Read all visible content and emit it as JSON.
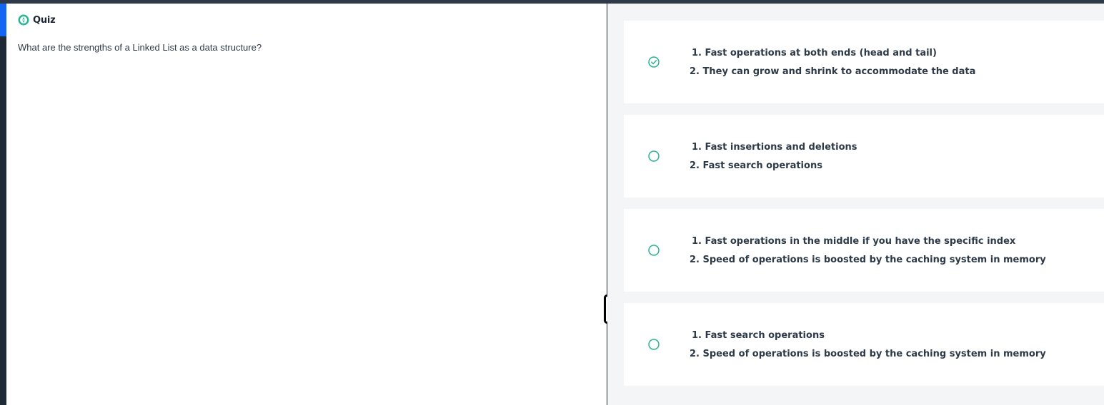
{
  "quiz": {
    "icon": "quiz-compass-icon",
    "title": "Quiz",
    "question": "What are the strengths of a Linked List as a data structure?"
  },
  "colors": {
    "accent_teal": "#2bb594",
    "top_bar": "#2e3a4a",
    "left_rail": "#1f2a37",
    "rail_highlight": "#1266f1",
    "answers_background": "#f4f5f7",
    "text": "#2d3a48"
  },
  "options": [
    {
      "selected": true,
      "icon": "check-circle-icon",
      "line1": "1. Fast operations at both ends (head and tail)",
      "line2": "2. They can grow and shrink to accommodate the data"
    },
    {
      "selected": false,
      "icon": "radio-circle-icon",
      "line1": "1. Fast insertions and deletions",
      "line2": "2. Fast search operations"
    },
    {
      "selected": false,
      "icon": "radio-circle-icon",
      "line1": "1. Fast operations in the middle if you have the specific index",
      "line2": "2. Speed of operations is boosted by the caching system in memory"
    },
    {
      "selected": false,
      "icon": "radio-circle-icon",
      "line1": "1. Fast search operations",
      "line2": "2. Speed of operations is boosted by the caching system in memory"
    }
  ]
}
